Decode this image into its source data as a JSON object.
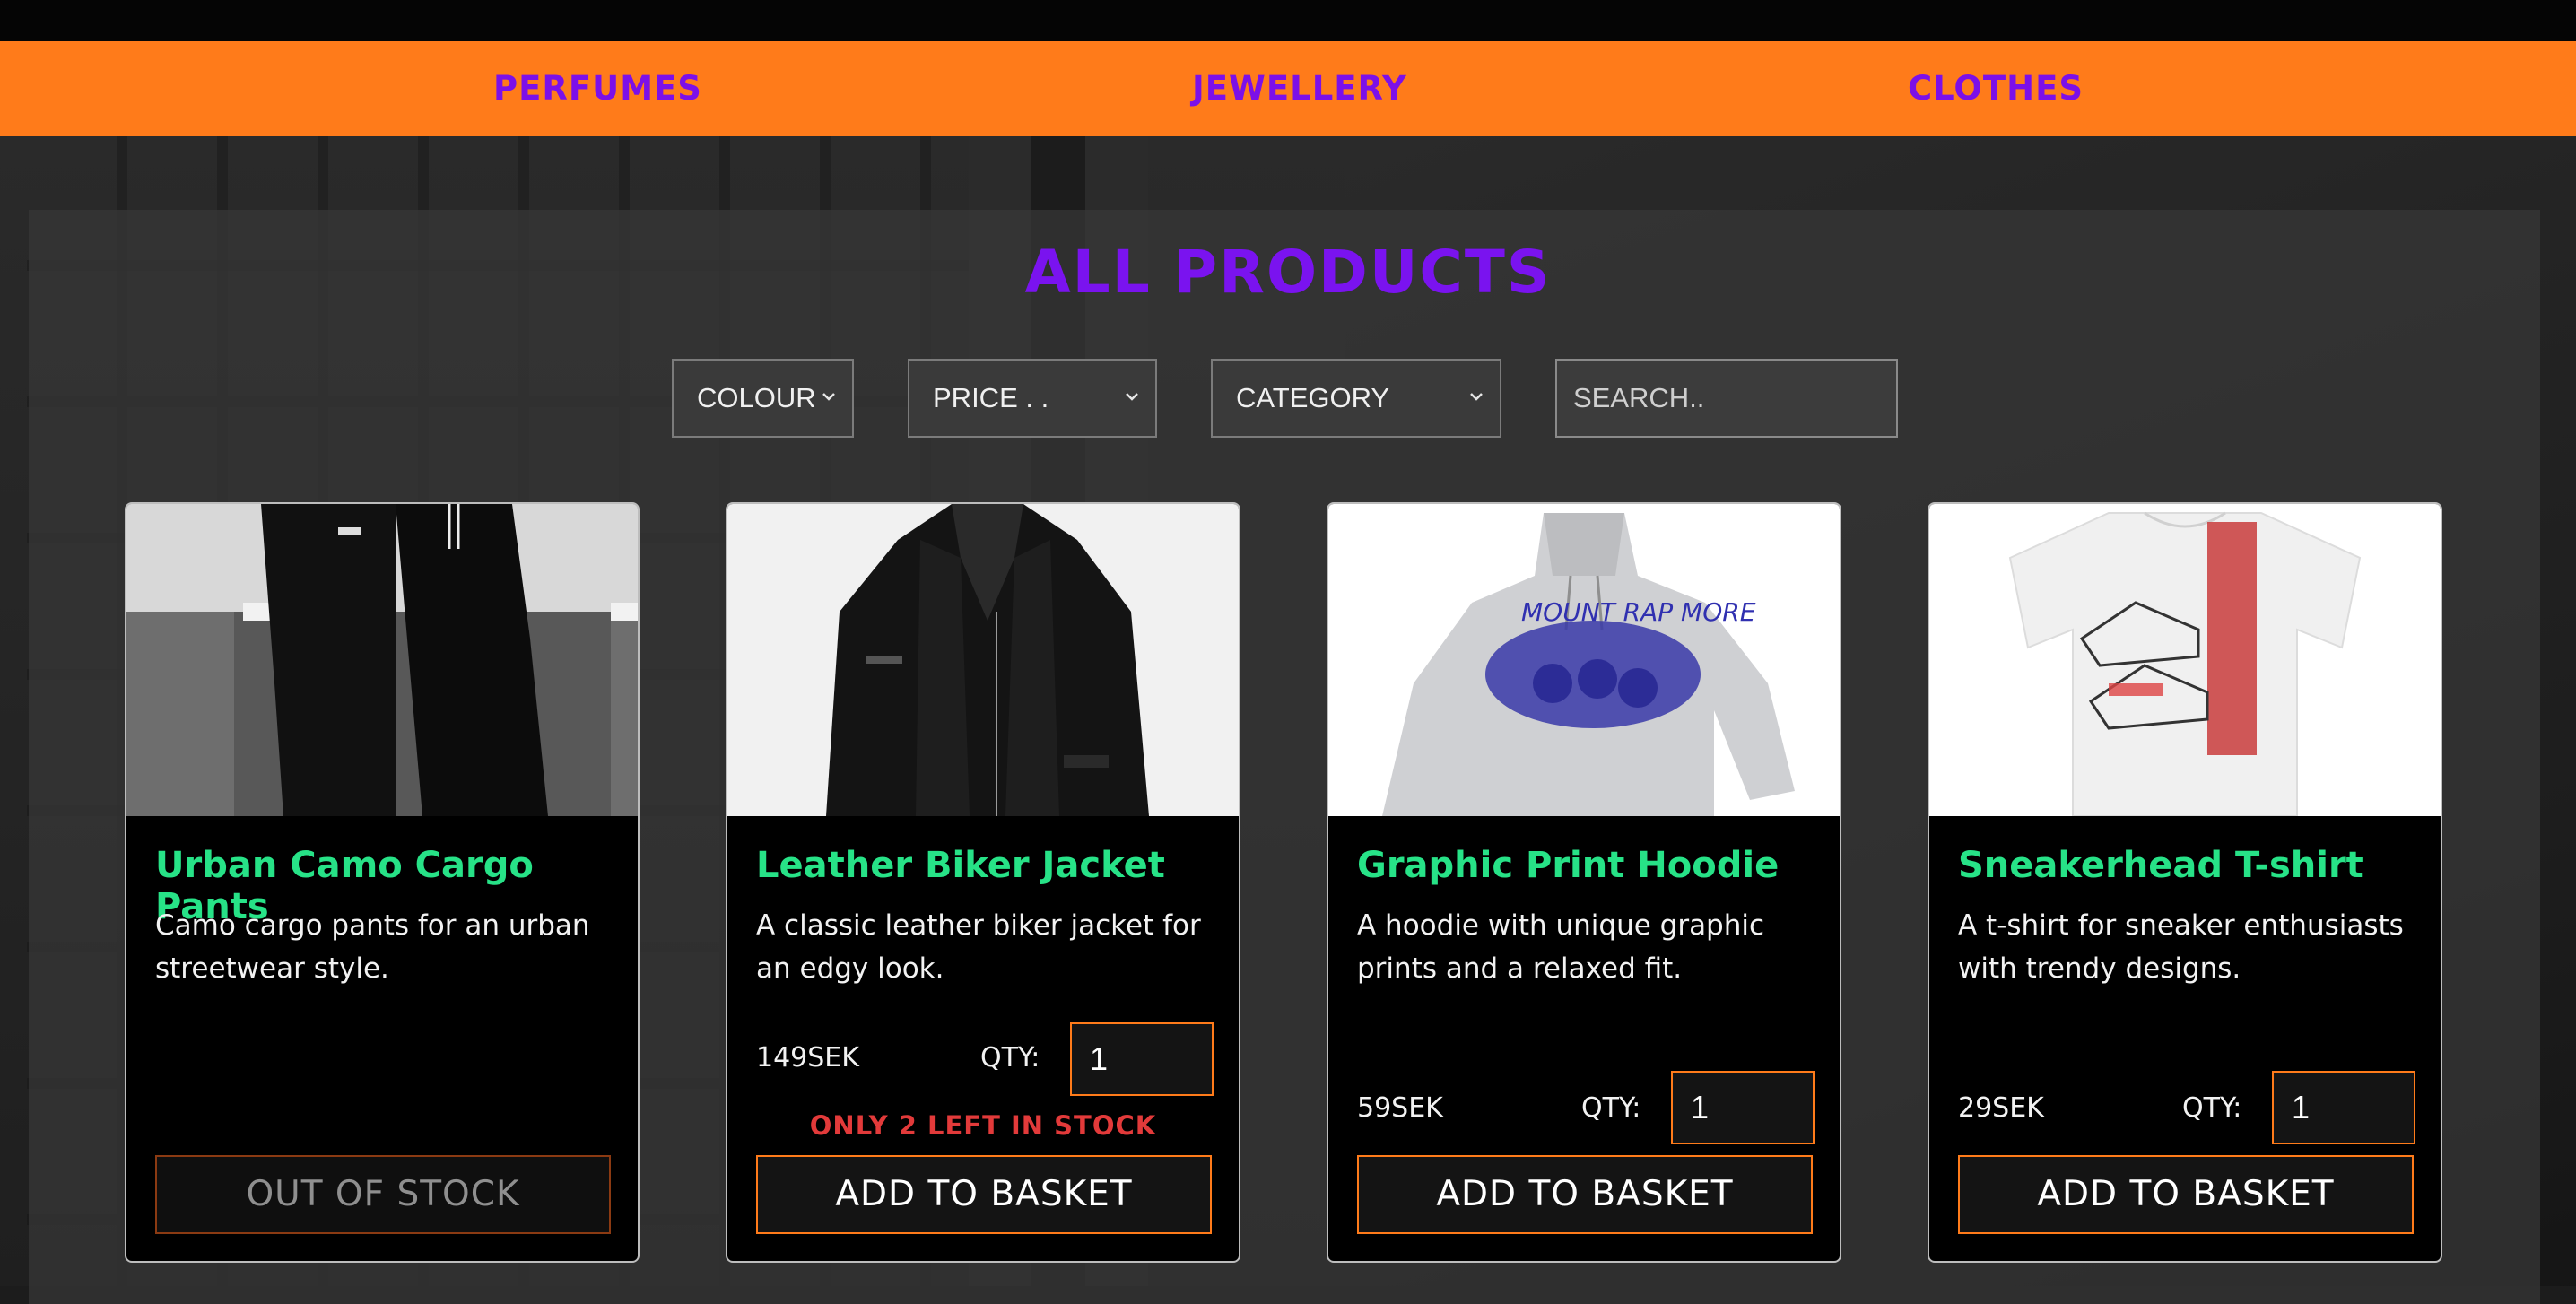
{
  "nav": {
    "items": [
      "PERFUMES",
      "JEWELLERY",
      "CLOTHES"
    ]
  },
  "page": {
    "title": "ALL PRODUCTS"
  },
  "filters": {
    "colour": "COLOUR",
    "price": "PRICE . .",
    "category": "CATEGORY",
    "search_placeholder": "SEARCH.."
  },
  "products": [
    {
      "name": "Urban Camo Cargo Pants",
      "description": "Camo cargo pants for an urban streetwear style.",
      "button": "OUT OF STOCK"
    },
    {
      "name": "Leather Biker Jacket",
      "description": "A classic leather biker jacket for an edgy look.",
      "price": "149SEK",
      "qty_label": "QTY:",
      "qty": "1",
      "stock_note": "ONLY 2 LEFT IN STOCK",
      "button": "ADD TO BASKET"
    },
    {
      "name": "Graphic Print Hoodie",
      "description": "A hoodie with unique graphic prints and a relaxed fit.",
      "price": "59SEK",
      "qty_label": "QTY:",
      "qty": "1",
      "button": "ADD TO BASKET"
    },
    {
      "name": "Sneakerhead T-shirt",
      "description": "A t-shirt for sneaker enthusiasts with trendy designs.",
      "price": "29SEK",
      "qty_label": "QTY:",
      "qty": "1",
      "button": "ADD TO BASKET"
    }
  ],
  "colors": {
    "nav_bg": "#ff7b1a",
    "accent_purple": "#7c10e8",
    "product_name": "#27e287",
    "stock_warning": "#e23a3a"
  }
}
